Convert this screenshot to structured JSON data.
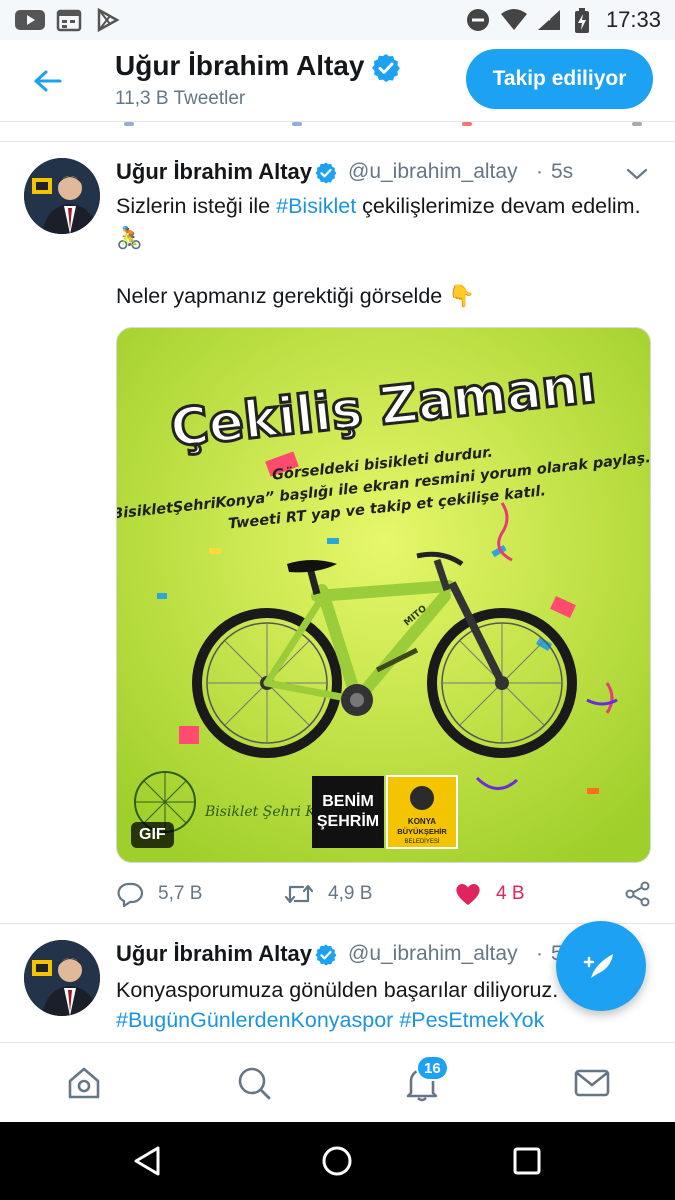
{
  "status_bar": {
    "time": "17:33"
  },
  "header": {
    "name": "Uğur İbrahim Altay",
    "tweet_count": "11,3 B Tweetler",
    "follow_label": "Takip ediliyor"
  },
  "tweet1": {
    "name": "Uğur İbrahim Altay",
    "handle": "@u_ibrahim_altay",
    "time": "5s",
    "text_before": "Sizlerin isteği ile ",
    "hashtag": "#Bisiklet",
    "text_after": " çekilişlerimize devam edelim. 🚴",
    "text_line2": "Neler yapmanız gerektiği görselde 👇",
    "media": {
      "title": "Çekiliş Zamanı",
      "instructions": [
        "Görseldeki bisikleti durdur.",
        "“BisikletŞehriKonya” başlığı ile ekran resmini yorum olarak paylaş.",
        "Tweeti RT yap ve takip et çekilişe katıl."
      ],
      "logo_left": "Bisiklet Şehri Konya",
      "logo_benim_1": "BENİM",
      "logo_benim_2": "ŞEHRİM",
      "logo_konya_1": "KONYA",
      "logo_konya_2": "BÜYÜKŞEHİR",
      "logo_konya_3": "BELEDİYESİ",
      "gif_label": "GIF",
      "bike_brand": "MITO"
    },
    "actions": {
      "replies": "5,7 B",
      "retweets": "4,9 B",
      "likes": "4 B"
    }
  },
  "tweet2": {
    "name": "Uğur İbrahim Altay",
    "handle": "@u_ibrahim_altay",
    "time": "5",
    "text": "Konyasporumuza gönülden başarılar diliyoruz.",
    "hashtag1": "#BugünGünlerdenKonyaspor",
    "hashtag2": "#PesEtmekYok"
  },
  "bottom_nav": {
    "notifications_badge": "16"
  },
  "colors": {
    "accent": "#1da1f2",
    "like": "#e0245e",
    "media_bg": "#c6e63a"
  }
}
